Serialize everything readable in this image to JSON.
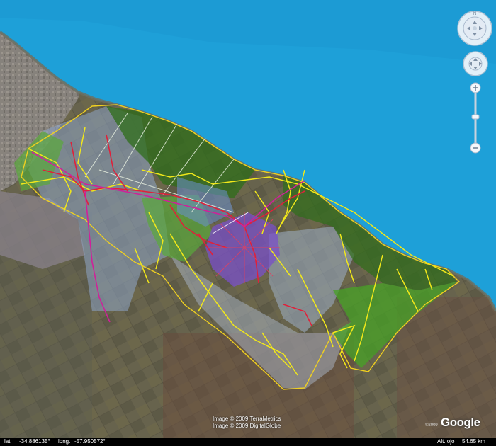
{
  "attribution": {
    "line1": "Image © 2009 TerraMetrics",
    "line2": "Image © 2009 DigitalGlobe"
  },
  "logo": {
    "text": "Google",
    "copyright": "©2009"
  },
  "status": {
    "lat_label": "lat.",
    "lat_value": "-34.886135°",
    "lon_label": "long.",
    "lon_value": "-57.950572°",
    "alt_label": "Alt. ojo",
    "alt_value": "54.65 km"
  },
  "icons": {
    "navigation": "compass-icon",
    "look": "look-joystick-icon",
    "zoom_in": "zoom-in-icon",
    "zoom_out": "zoom-out-icon"
  },
  "colors": {
    "water": "#1ea0d8",
    "overlay_green": "#3f8a1f",
    "overlay_blue": "#7f9fc0",
    "overlay_purple": "#7a50c8",
    "road_yellow": "#f2e81a",
    "road_red": "#e0203a",
    "road_magenta": "#d0209a",
    "boundary": "#f0d020"
  }
}
